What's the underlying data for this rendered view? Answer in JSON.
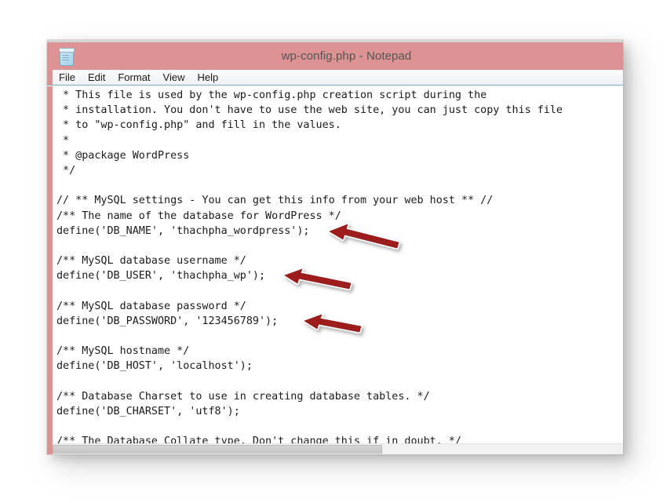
{
  "window": {
    "title": "wp-config.php - Notepad",
    "icon": "notepad-icon",
    "titlebar_color": "#dd9294",
    "accent_strip_color": "#dd9294",
    "menu_underline_color": "#7fa8cd"
  },
  "menu": {
    "items": [
      {
        "label": "File"
      },
      {
        "label": "Edit"
      },
      {
        "label": "Format"
      },
      {
        "label": "View"
      },
      {
        "label": "Help"
      }
    ]
  },
  "editor": {
    "lines": [
      " * This file is used by the wp-config.php creation script during the",
      " * installation. You don't have to use the web site, you can just copy this file",
      " * to \"wp-config.php\" and fill in the values.",
      " *",
      " * @package WordPress",
      " */",
      "",
      "// ** MySQL settings - You can get this info from your web host ** //",
      "/** The name of the database for WordPress */",
      "define('DB_NAME', 'thachpha_wordpress');",
      "",
      "/** MySQL database username */",
      "define('DB_USER', 'thachpha_wp');",
      "",
      "/** MySQL database password */",
      "define('DB_PASSWORD', '123456789');",
      "",
      "/** MySQL hostname */",
      "define('DB_HOST', 'localhost');",
      "",
      "/** Database Charset to use in creating database tables. */",
      "define('DB_CHARSET', 'utf8');",
      "",
      "/** The Database Collate type. Don't change this if in doubt. */"
    ],
    "text_color": "#1b1b1b",
    "background_color": "#ffffff"
  },
  "annotations": {
    "arrow_color": "#9e1f1f",
    "arrows": [
      {
        "label": "arrow-db-name",
        "points_to": "define('DB_NAME', 'thachpha_wordpress');"
      },
      {
        "label": "arrow-db-user",
        "points_to": "define('DB_USER', 'thachpha_wp');"
      },
      {
        "label": "arrow-db-password",
        "points_to": "define('DB_PASSWORD', '123456789');"
      }
    ]
  },
  "scrollbar": {
    "orientation": "horizontal",
    "thumb_position": "start"
  }
}
